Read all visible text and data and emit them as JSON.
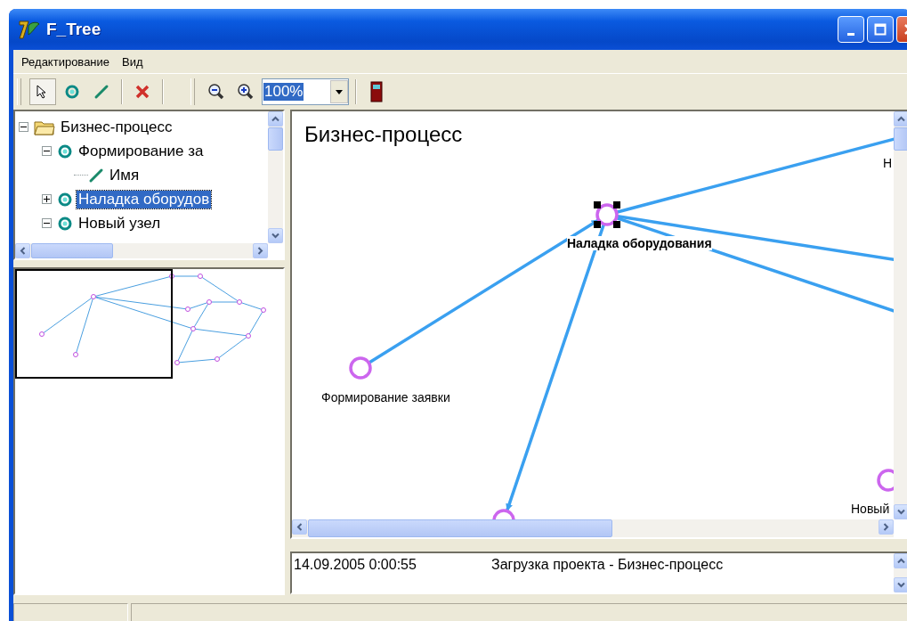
{
  "window": {
    "title": "F_Tree"
  },
  "menu": [
    {
      "label": "Редактирование"
    },
    {
      "label": "Вид"
    }
  ],
  "toolbar": [
    {
      "kind": "pointer",
      "selected": true
    },
    {
      "kind": "node",
      "selected": false
    },
    {
      "kind": "link",
      "selected": false
    },
    {
      "kind": "delete",
      "selected": false
    },
    {
      "kind": "zoom-out",
      "selected": false
    },
    {
      "kind": "zoom-in",
      "selected": false
    },
    {
      "kind": "zoom",
      "value": "100%"
    },
    {
      "kind": "exit",
      "selected": false
    }
  ],
  "tree": [
    {
      "label": "Бизнес-процесс",
      "kind": "folder",
      "expanded": true,
      "selected": false,
      "children": [
        {
          "label": "Формирование за",
          "kind": "node",
          "expanded": true,
          "selected": false,
          "children": [
            {
              "label": "Имя",
              "kind": "link",
              "selected": false
            }
          ]
        },
        {
          "label": "Наладка оборудов",
          "kind": "node",
          "expanded": false,
          "selected": true
        },
        {
          "label": "Новый узел",
          "kind": "node",
          "expanded": true,
          "selected": false
        }
      ]
    }
  ],
  "canvas": {
    "title": "Бизнес-процесс",
    "nodes": [
      {
        "label": "Наладка оборудования",
        "selected": true
      },
      {
        "label": "Формирование заявки",
        "selected": false
      },
      {
        "selected": false
      },
      {
        "label": "Новый",
        "selected": false
      }
    ],
    "cut_label": "Н"
  },
  "log": [
    {
      "time": "14.09.2005 0:00:55",
      "message": "Загрузка проекта - Бизнес-процесс"
    }
  ]
}
